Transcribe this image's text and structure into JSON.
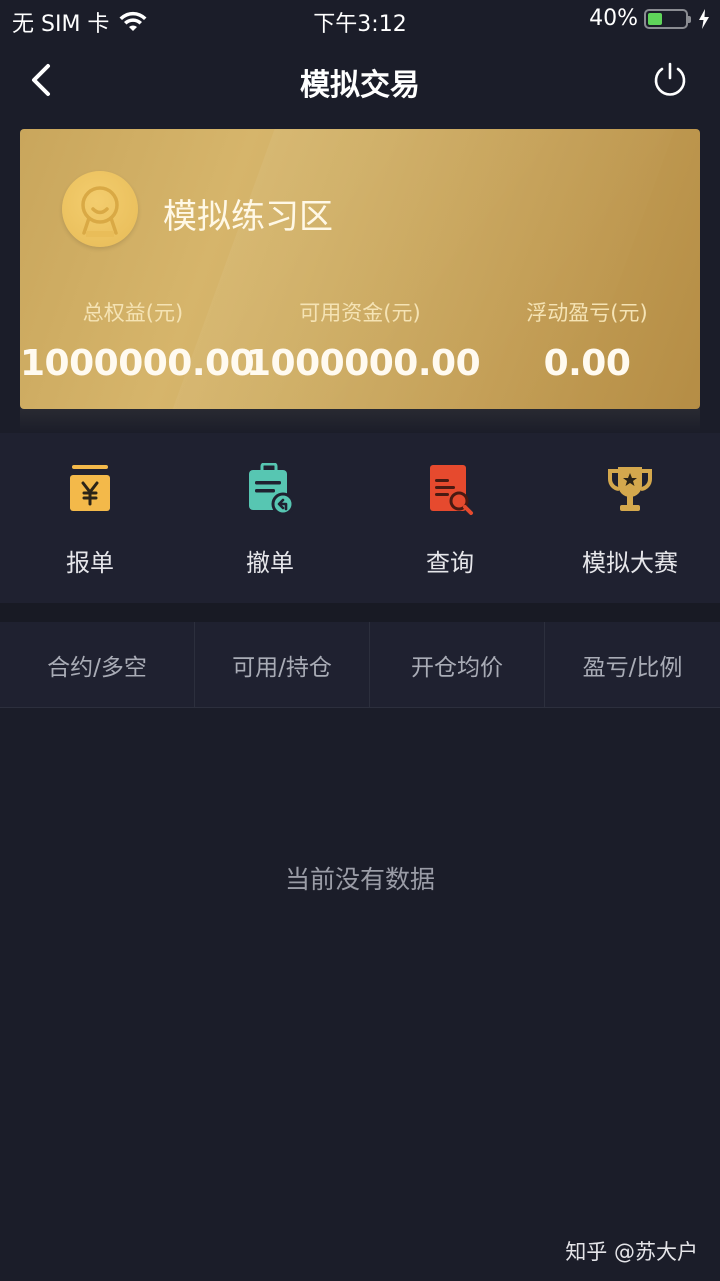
{
  "status_bar": {
    "carrier": "无 SIM 卡",
    "time": "下午3:12",
    "battery_percent_label": "40%",
    "battery_level": 0.4,
    "charging": true
  },
  "nav": {
    "title": "模拟交易",
    "back_icon": "chevron-left-icon",
    "power_icon": "power-icon"
  },
  "card": {
    "title": "模拟练习区",
    "stats": [
      {
        "label": "总权益(元)",
        "value": "1000000.00"
      },
      {
        "label": "可用资金(元)",
        "value": "1000000.00"
      },
      {
        "label": "浮动盈亏(元)",
        "value": "0.00"
      }
    ]
  },
  "actions": [
    {
      "label": "报单",
      "icon": "yen-order-icon",
      "color": "#f3b94a"
    },
    {
      "label": "撤单",
      "icon": "clipboard-undo-icon",
      "color": "#57c6b2"
    },
    {
      "label": "查询",
      "icon": "document-search-icon",
      "color": "#e64a2e"
    },
    {
      "label": "模拟大赛",
      "icon": "trophy-icon",
      "color": "#d4a84d"
    }
  ],
  "table": {
    "headers": [
      "合约/多空",
      "可用/持仓",
      "开仓均价",
      "盈亏/比例"
    ],
    "rows": []
  },
  "empty_message": "当前没有数据",
  "watermark": "知乎 @苏大户"
}
